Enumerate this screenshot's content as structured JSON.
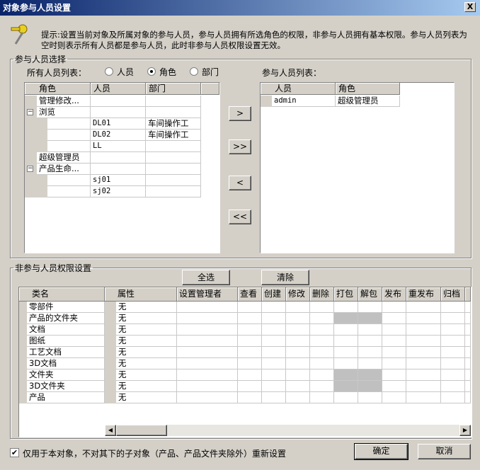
{
  "window": {
    "title": "对象参与人员设置",
    "close": "X"
  },
  "hint": "提示:设置当前对象及所属对象的参与人员，参与人员拥有所选角色的权限，非参与人员拥有基本权限。参与人员列表为空时则表示所有人员都是参与人员，此时非参与人员权限设置无效。",
  "select_group": {
    "legend": "参与人员选择",
    "all_label": "所有人员列表：",
    "radios": [
      "人员",
      "角色",
      "部门"
    ],
    "selected": "角色",
    "participants_label": "参与人员列表："
  },
  "all_table": {
    "headers": [
      "角色",
      "人员",
      "部门"
    ],
    "rows": [
      {
        "role": "管理修改...",
        "person": "",
        "dept": "",
        "level": 0,
        "toggle": ""
      },
      {
        "role": "浏览",
        "person": "",
        "dept": "",
        "level": 0,
        "toggle": "⊟"
      },
      {
        "role": "",
        "person": "DL01",
        "dept": "车间操作工",
        "level": 1,
        "toggle": ""
      },
      {
        "role": "",
        "person": "DL02",
        "dept": "车间操作工",
        "level": 1,
        "toggle": ""
      },
      {
        "role": "",
        "person": "LL",
        "dept": "",
        "level": 1,
        "toggle": ""
      },
      {
        "role": "超级管理员",
        "person": "",
        "dept": "",
        "level": 0,
        "toggle": ""
      },
      {
        "role": "产品生命...",
        "person": "",
        "dept": "",
        "level": 0,
        "toggle": "⊟"
      },
      {
        "role": "",
        "person": "sj01",
        "dept": "",
        "level": 1,
        "toggle": ""
      },
      {
        "role": "",
        "person": "sj02",
        "dept": "",
        "level": 1,
        "toggle": ""
      }
    ]
  },
  "move_buttons": [
    ">",
    ">>",
    "<",
    "<<"
  ],
  "participants_table": {
    "headers": [
      "人员",
      "角色"
    ],
    "rows": [
      {
        "person": "admin",
        "role": "超级管理员"
      }
    ]
  },
  "perm_group": {
    "legend": "非参与人员权限设置",
    "select_all": "全选",
    "clear": "清除",
    "headers": [
      "类名",
      "属性",
      "设置管理者",
      "查看",
      "创建",
      "修改",
      "删除",
      "打包",
      "解包",
      "发布",
      "重发布",
      "归档"
    ],
    "rows": [
      {
        "name": "零部件",
        "attr": "无",
        "disabled": []
      },
      {
        "name": "产品的文件夹",
        "attr": "无",
        "disabled": [
          7,
          8
        ]
      },
      {
        "name": "文档",
        "attr": "无",
        "disabled": []
      },
      {
        "name": "图纸",
        "attr": "无",
        "disabled": []
      },
      {
        "name": "工艺文档",
        "attr": "无",
        "disabled": []
      },
      {
        "name": "3D文档",
        "attr": "无",
        "disabled": []
      },
      {
        "name": "文件夹",
        "attr": "无",
        "disabled": [
          7,
          8
        ]
      },
      {
        "name": "3D文件夹",
        "attr": "无",
        "disabled": [
          7,
          8
        ]
      },
      {
        "name": "产品",
        "attr": "无",
        "disabled": []
      }
    ]
  },
  "footer": {
    "checkbox_label": "仅用于本对象，不对其下的子对象（产品、产品文件夹除外）重新设置",
    "checked": true,
    "ok": "确定",
    "cancel": "取消"
  }
}
